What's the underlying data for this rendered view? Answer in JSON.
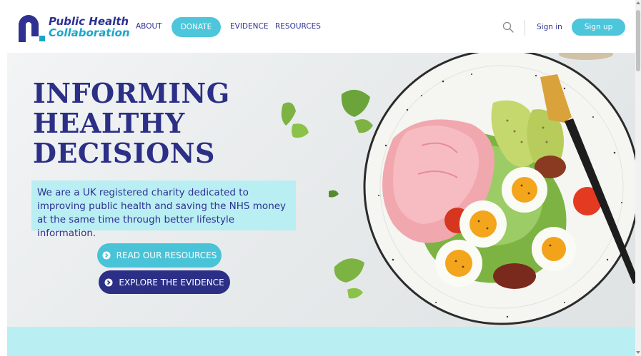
{
  "brand": {
    "name_line1": "Public Health",
    "name_line2": "Collaboration",
    "colors": {
      "navy": "#2e3192",
      "cyan": "#4dc6dc",
      "light_cyan": "#b9eef3"
    }
  },
  "nav": {
    "about": "ABOUT",
    "donate": "DONATE",
    "evidence": "EVIDENCE",
    "resources": "RESOURCES"
  },
  "header_actions": {
    "search_icon": "search-icon",
    "sign_in": "Sign in",
    "sign_up": "Sign up"
  },
  "hero": {
    "title_lines": [
      "INFORMING",
      "HEALTHY",
      "DECISIONS"
    ],
    "description": "We are a UK registered charity dedicated to improving public health and saving the NHS money at the same time through better lifestyle information.",
    "buttons": {
      "resources": "READ OUR RESOURCES",
      "evidence": "EXPLORE THE EVIDENCE"
    },
    "image": "plate-of-ham-eggs-avocado-salad"
  }
}
